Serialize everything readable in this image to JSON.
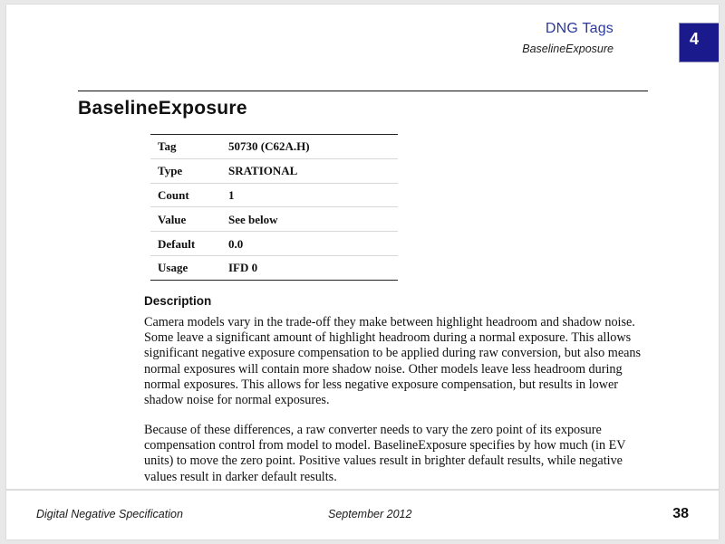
{
  "document": {
    "header": {
      "section_title": "DNG Tags",
      "subtitle": "BaselineExposure",
      "chapter_number": "4",
      "chapter_box_color": "#1a1a8c",
      "section_title_color": "#2b3a9c"
    },
    "title": "BaselineExposure",
    "spec_table": {
      "rows": [
        {
          "label": "Tag",
          "value": "50730 (C62A.H)"
        },
        {
          "label": "Type",
          "value": "SRATIONAL"
        },
        {
          "label": "Count",
          "value": "1"
        },
        {
          "label": "Value",
          "value": "See below"
        },
        {
          "label": "Default",
          "value": "0.0"
        },
        {
          "label": "Usage",
          "value": "IFD 0"
        }
      ]
    },
    "description": {
      "heading": "Description",
      "paragraphs": [
        "Camera models vary in the trade-off they make between highlight headroom and shadow noise. Some leave a significant amount of highlight headroom during a normal exposure. This allows significant negative exposure compensation to be applied during raw conversion, but also means normal exposures will contain more shadow noise. Other models leave less headroom during normal exposures. This allows for less negative exposure compensation, but results in lower shadow noise for normal exposures.",
        "Because of these differences, a raw converter needs to vary the zero point of its exposure compensation control from model to model. BaselineExposure specifies by how much (in EV units) to move the zero point. Positive values result in brighter default results, while negative values result in darker default results."
      ]
    },
    "footer": {
      "left": "Digital Negative Specification",
      "center": "September 2012",
      "page_number": "38"
    }
  }
}
